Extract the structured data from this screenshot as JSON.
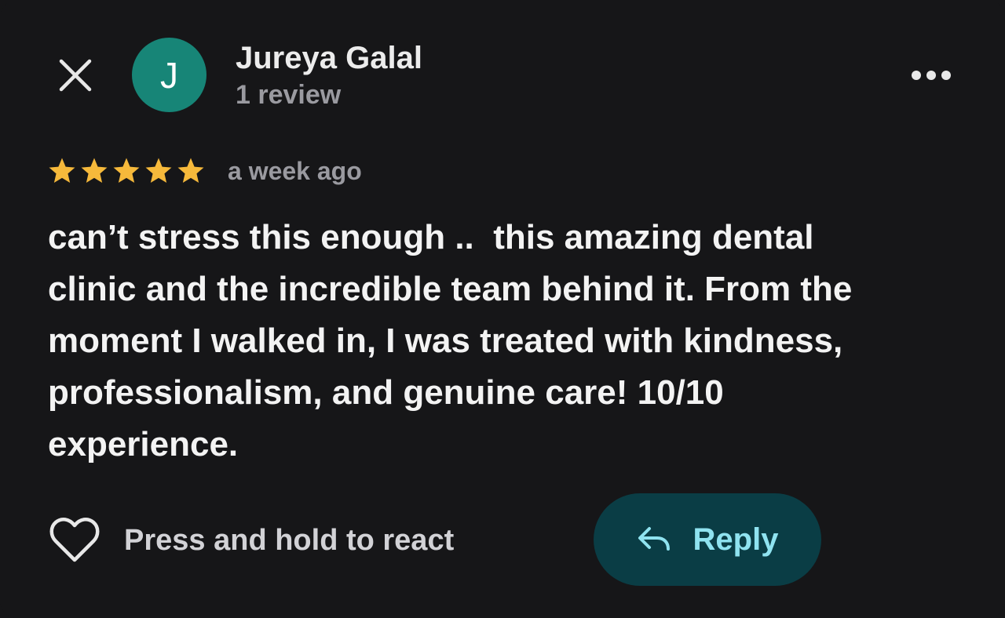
{
  "reviewer": {
    "avatar_initial": "J",
    "avatar_color": "#178577",
    "name": "Jureya Galal",
    "review_count": "1 review"
  },
  "review": {
    "rating": 5,
    "rating_max": 5,
    "star_color": "#f6b93b",
    "time": "a week ago",
    "text": "can’t stress this enough ..  this amazing dental\nclinic and the incredible team behind it. From the\nmoment I walked in, I was treated with kindness,\nprofessionalism, and genuine care! 10/10\nexperience."
  },
  "actions": {
    "react_label": "Press and hold to react",
    "reply_label": "Reply",
    "reply_accent": "#8fe3f0"
  },
  "icons": {
    "close": "close-icon",
    "more": "more-horizontal-icon",
    "heart": "heart-outline-icon",
    "reply": "reply-arrow-icon",
    "star": "star-filled-icon"
  }
}
